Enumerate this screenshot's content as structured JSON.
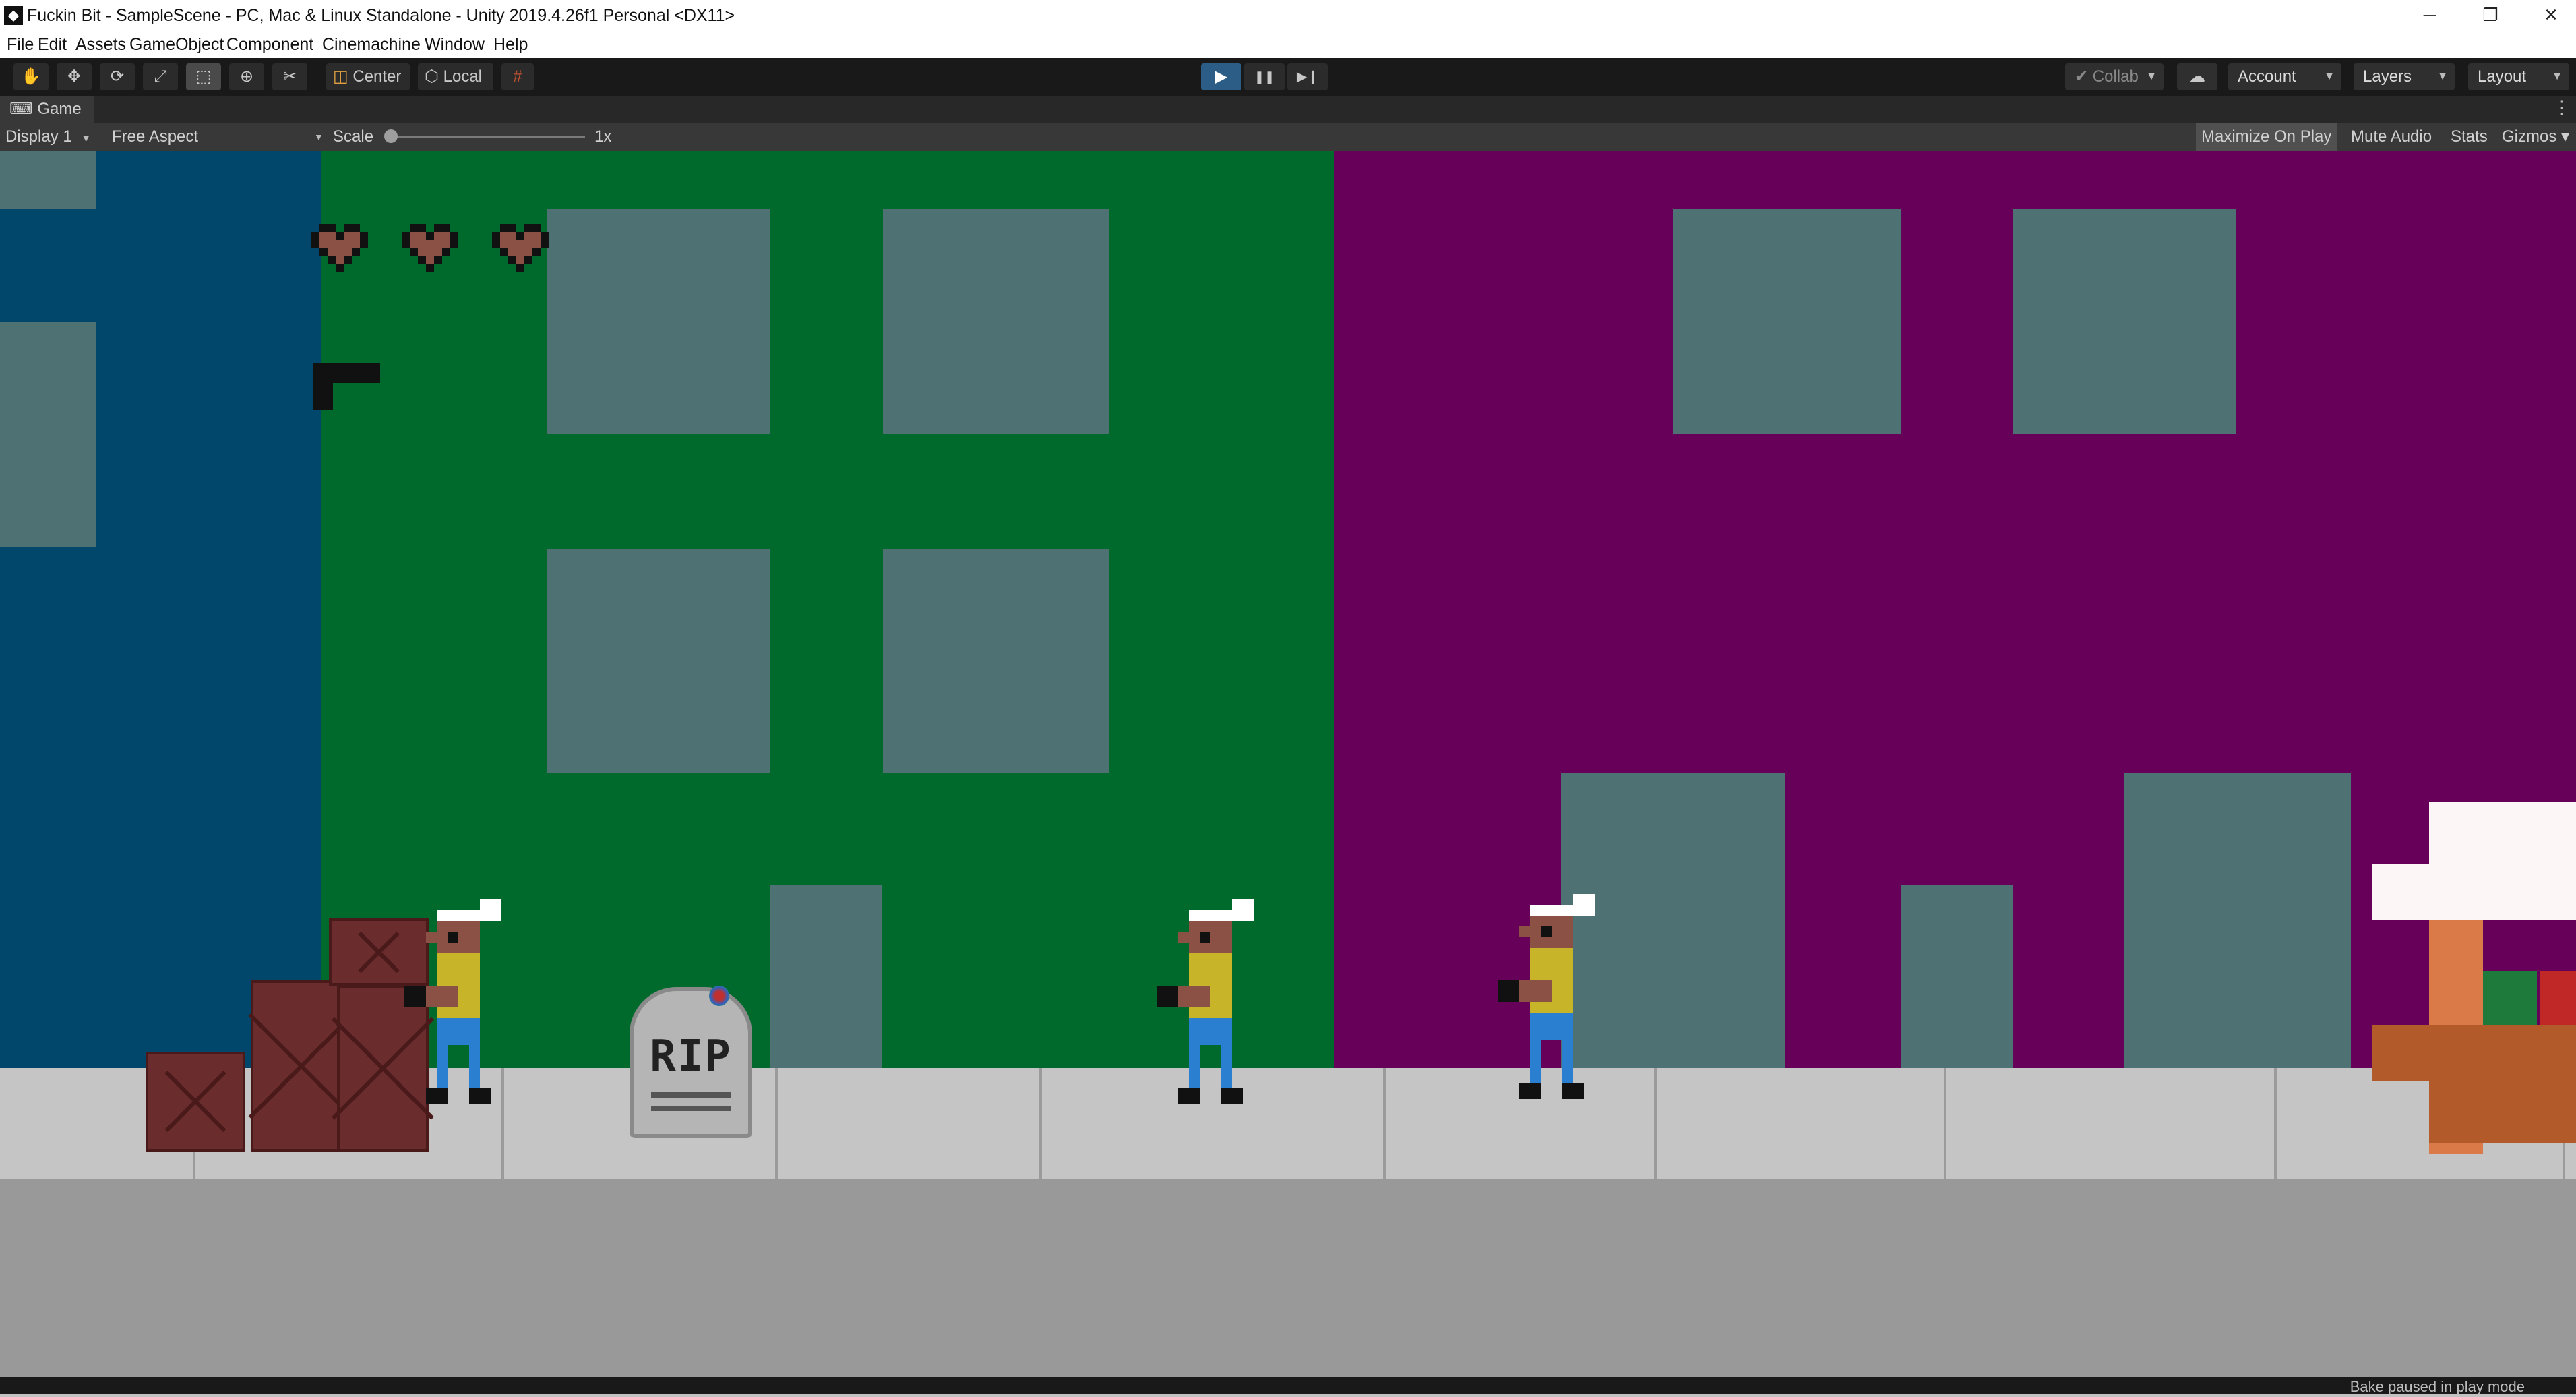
{
  "window": {
    "title": "Fuckin Bit - SampleScene - PC, Mac & Linux Standalone - Unity 2019.4.26f1 Personal <DX11>",
    "app_icon": "unity-icon",
    "controls": {
      "minimize": "─",
      "maximize": "❐",
      "close": "✕"
    }
  },
  "menu": {
    "items": [
      "File",
      "Edit",
      "Assets",
      "GameObject",
      "Component",
      "Cinemachine",
      "Window",
      "Help"
    ]
  },
  "toolbar": {
    "tools": [
      {
        "name": "hand-tool",
        "glyph": "✋"
      },
      {
        "name": "move-tool",
        "glyph": "✥"
      },
      {
        "name": "rotate-tool",
        "glyph": "⟳"
      },
      {
        "name": "scale-tool",
        "glyph": "⤢"
      },
      {
        "name": "rect-tool",
        "glyph": "⬚",
        "active": true
      },
      {
        "name": "transform-tool",
        "glyph": "⊕"
      },
      {
        "name": "custom-tool",
        "glyph": "✂"
      }
    ],
    "pivot_label": "Center",
    "space_label": "Local",
    "snap_icon": "grid-snap-icon",
    "play": {
      "play": "▶",
      "pause": "❚❚",
      "step": "▶❙",
      "playing": true
    },
    "collab_label": "Collab",
    "cloud_icon": "cloud-icon",
    "account_label": "Account",
    "layers_label": "Layers",
    "layout_label": "Layout"
  },
  "game_view": {
    "tab_label": "Game",
    "display": "Display 1",
    "aspect": "Free Aspect",
    "scale_label": "Scale",
    "scale_value": "1x",
    "scale_level": 0.0,
    "buttons": [
      {
        "label": "Maximize On Play",
        "on": true
      },
      {
        "label": "Mute Audio",
        "on": false
      },
      {
        "label": "Stats",
        "on": false
      },
      {
        "label": "Gizmos",
        "on": false
      }
    ]
  },
  "scene": {
    "colors": {
      "blue_building": "#00476b",
      "green_building": "#006a2c",
      "purple_building": "#660059",
      "window": "#4e7174",
      "sidewalk": "#c5c5c5",
      "road": "#999999",
      "crate": "#6a2c2c",
      "shirt": "#c8b428",
      "pants": "#2a7fd0",
      "skin": "#8c5145"
    },
    "hud": {
      "hearts": 3,
      "weapon_icon": "pistol-icon"
    },
    "tombstone_text": "RIP",
    "enemies": 3,
    "crates": 4
  },
  "status": {
    "text": "Bake paused in play mode"
  }
}
